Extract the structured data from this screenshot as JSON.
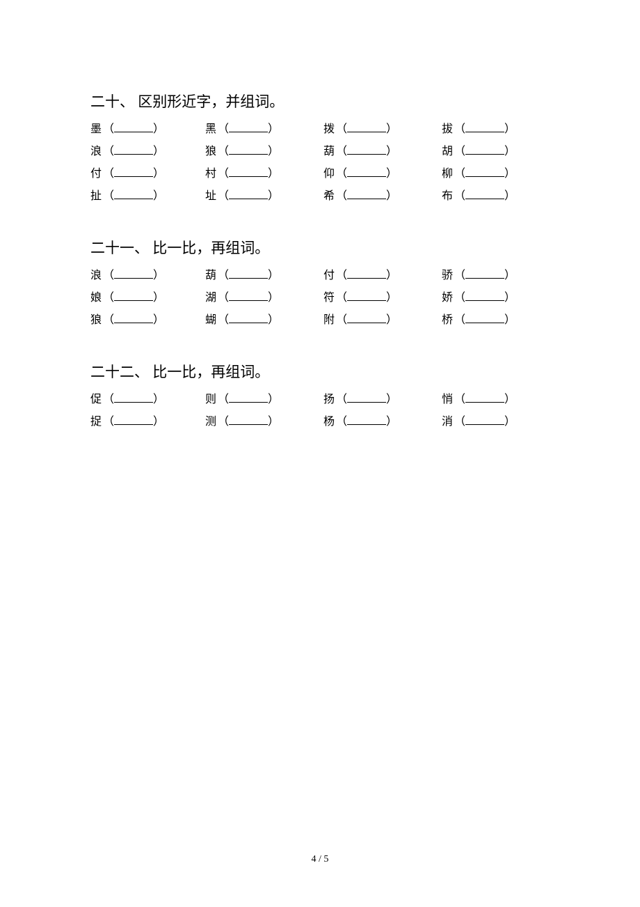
{
  "sections": [
    {
      "title": "二十、 区别形近字，并组词。",
      "rows": [
        [
          "墨",
          "黑",
          "拨",
          "拔"
        ],
        [
          "浪",
          "狼",
          "葫",
          "胡"
        ],
        [
          "付",
          "村",
          "仰",
          "柳"
        ],
        [
          "扯",
          "址",
          "希",
          "布"
        ]
      ]
    },
    {
      "title": "二十一、 比一比，再组词。",
      "rows": [
        [
          "浪",
          "葫",
          "付",
          "骄"
        ],
        [
          "娘",
          "湖",
          "符",
          "娇"
        ],
        [
          "狼",
          "蝴",
          "附",
          "桥"
        ]
      ]
    },
    {
      "title": "二十二、 比一比，再组词。",
      "rows": [
        [
          "促",
          "则",
          "扬",
          "悄"
        ],
        [
          "捉",
          "测",
          "杨",
          "消"
        ]
      ]
    }
  ],
  "pageNumber": "4 / 5"
}
